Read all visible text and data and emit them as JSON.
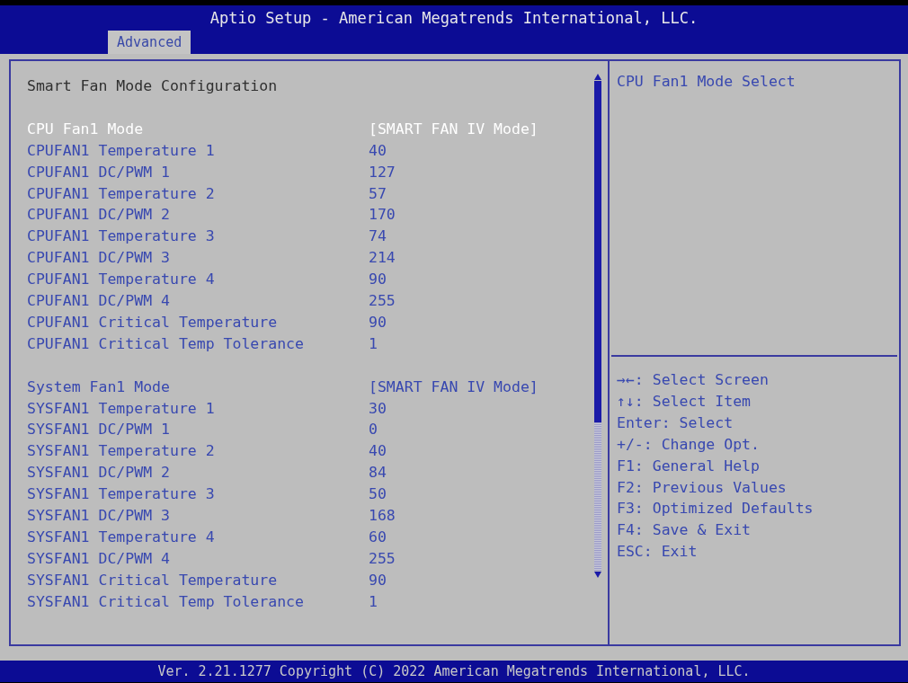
{
  "window": {
    "title": "Aptio Setup - American Megatrends International, LLC."
  },
  "tabs": [
    {
      "label": "Advanced",
      "selected": true
    }
  ],
  "page_title": "Smart Fan Mode Configuration",
  "groups": [
    {
      "items": [
        {
          "label": "CPU Fan1 Mode",
          "value": "[SMART FAN IV Mode]",
          "selected": true
        },
        {
          "label": "CPUFAN1 Temperature 1",
          "value": "40",
          "selected": false
        },
        {
          "label": "CPUFAN1 DC/PWM 1",
          "value": "127",
          "selected": false
        },
        {
          "label": "CPUFAN1 Temperature 2",
          "value": "57",
          "selected": false
        },
        {
          "label": "CPUFAN1 DC/PWM 2",
          "value": "170",
          "selected": false
        },
        {
          "label": "CPUFAN1 Temperature 3",
          "value": "74",
          "selected": false
        },
        {
          "label": "CPUFAN1 DC/PWM 3",
          "value": "214",
          "selected": false
        },
        {
          "label": "CPUFAN1 Temperature 4",
          "value": "90",
          "selected": false
        },
        {
          "label": "CPUFAN1 DC/PWM 4",
          "value": "255",
          "selected": false
        },
        {
          "label": "CPUFAN1 Critical Temperature",
          "value": "90",
          "selected": false
        },
        {
          "label": "CPUFAN1 Critical Temp Tolerance",
          "value": "1",
          "selected": false
        }
      ]
    },
    {
      "items": [
        {
          "label": "System Fan1 Mode",
          "value": "[SMART FAN IV Mode]",
          "selected": false
        },
        {
          "label": "SYSFAN1 Temperature 1",
          "value": "30",
          "selected": false
        },
        {
          "label": "SYSFAN1 DC/PWM 1",
          "value": "0",
          "selected": false
        },
        {
          "label": "SYSFAN1 Temperature 2",
          "value": "40",
          "selected": false
        },
        {
          "label": "SYSFAN1 DC/PWM 2",
          "value": "84",
          "selected": false
        },
        {
          "label": "SYSFAN1 Temperature 3",
          "value": "50",
          "selected": false
        },
        {
          "label": "SYSFAN1 DC/PWM 3",
          "value": "168",
          "selected": false
        },
        {
          "label": "SYSFAN1 Temperature 4",
          "value": "60",
          "selected": false
        },
        {
          "label": "SYSFAN1 DC/PWM 4",
          "value": "255",
          "selected": false
        },
        {
          "label": "SYSFAN1 Critical Temperature",
          "value": "90",
          "selected": false
        },
        {
          "label": "SYSFAN1 Critical Temp Tolerance",
          "value": "1",
          "selected": false
        }
      ]
    }
  ],
  "help_text": "CPU Fan1 Mode Select",
  "key_help": [
    "→←: Select Screen",
    "↑↓: Select Item",
    "Enter: Select",
    "+/-: Change Opt.",
    "F1: General Help",
    "F2: Previous Values",
    "F3: Optimized Defaults",
    "F4: Save & Exit",
    "ESC: Exit"
  ],
  "status_bar": "Ver. 2.21.1277 Copyright (C) 2022 American Megatrends International, LLC."
}
